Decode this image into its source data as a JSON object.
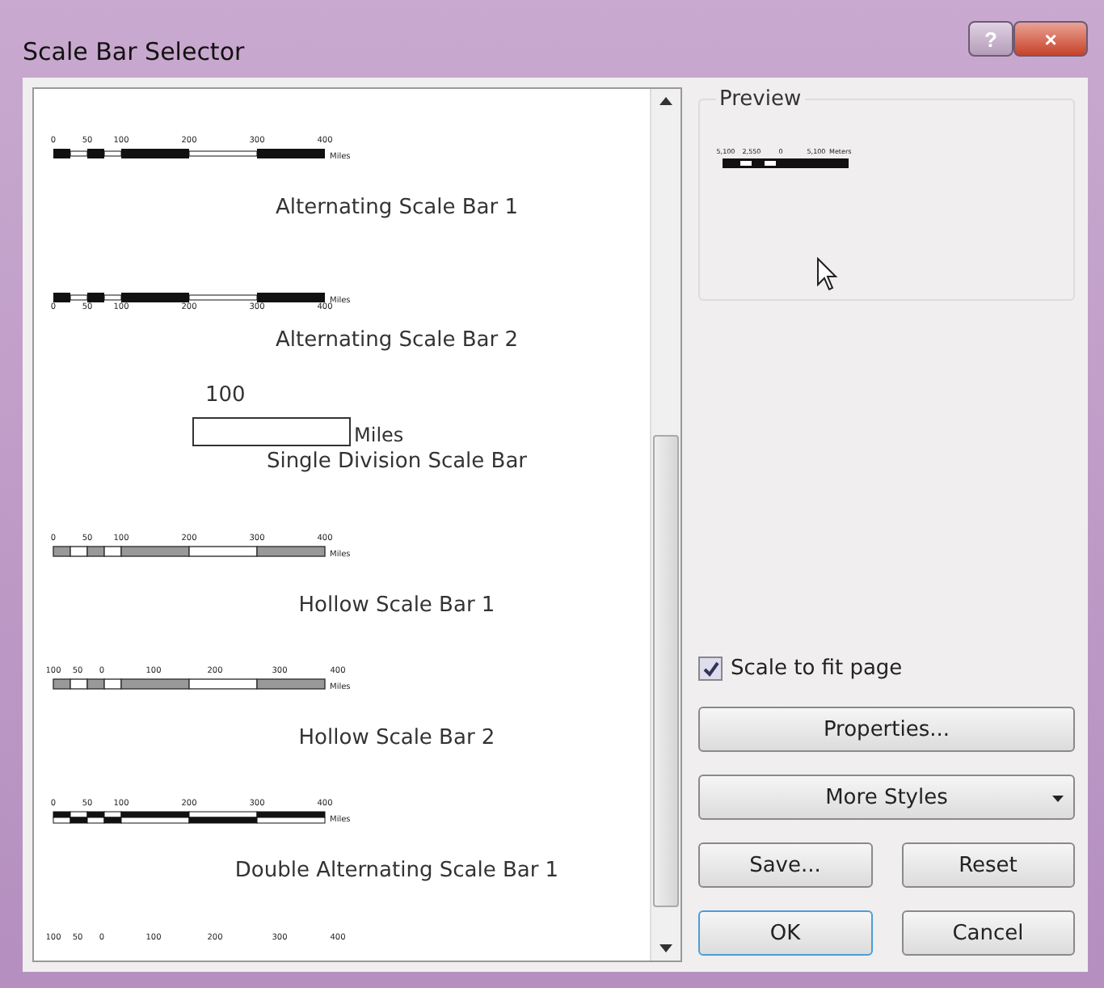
{
  "window": {
    "title": "Scale Bar Selector",
    "buttons": [
      "?",
      "×"
    ]
  },
  "styles": [
    {
      "kind": "alternating",
      "ticks": [
        "0",
        "50",
        "100",
        "200",
        "300",
        "400"
      ],
      "unit": "Miles",
      "label": "Alternating Scale Bar 1"
    },
    {
      "kind": "alternating-below",
      "ticks": [
        "0",
        "50",
        "100",
        "200",
        "300",
        "400"
      ],
      "unit": "Miles",
      "label": "Alternating Scale Bar 2"
    },
    {
      "kind": "single",
      "ticks": [
        "100"
      ],
      "unit": "Miles",
      "label": "Single Division Scale Bar"
    },
    {
      "kind": "hollow",
      "ticks": [
        "0",
        "50",
        "100",
        "200",
        "300",
        "400"
      ],
      "unit": "Miles",
      "label": "Hollow Scale Bar 1"
    },
    {
      "kind": "hollow-alt",
      "ticks": [
        "100",
        "50",
        "0",
        "100",
        "200",
        "300",
        "400"
      ],
      "unit": "Miles",
      "label": "Hollow Scale Bar 2"
    },
    {
      "kind": "double",
      "ticks": [
        "0",
        "50",
        "100",
        "200",
        "300",
        "400"
      ],
      "unit": "Miles",
      "label": "Double Alternating Scale Bar 1"
    },
    {
      "kind": "ticks-only",
      "ticks": [
        "100",
        "50",
        "0",
        "100",
        "200",
        "300",
        "400"
      ]
    }
  ],
  "preview": {
    "title": "Preview",
    "ticks": [
      "5,100",
      "2,550",
      "0",
      "5,100"
    ],
    "unit": "Meters"
  },
  "scale_to_fit": {
    "label": "Scale to fit page",
    "checked": true
  },
  "buttons": [
    {
      "kind": "wide",
      "label": "Properties..."
    },
    {
      "kind": "dropdown",
      "label": "More Styles"
    },
    {
      "kind": "half",
      "label": "Save..."
    },
    {
      "kind": "half",
      "label": "Reset"
    },
    {
      "kind": "default",
      "label": "OK"
    },
    {
      "kind": "half",
      "label": "Cancel"
    }
  ]
}
